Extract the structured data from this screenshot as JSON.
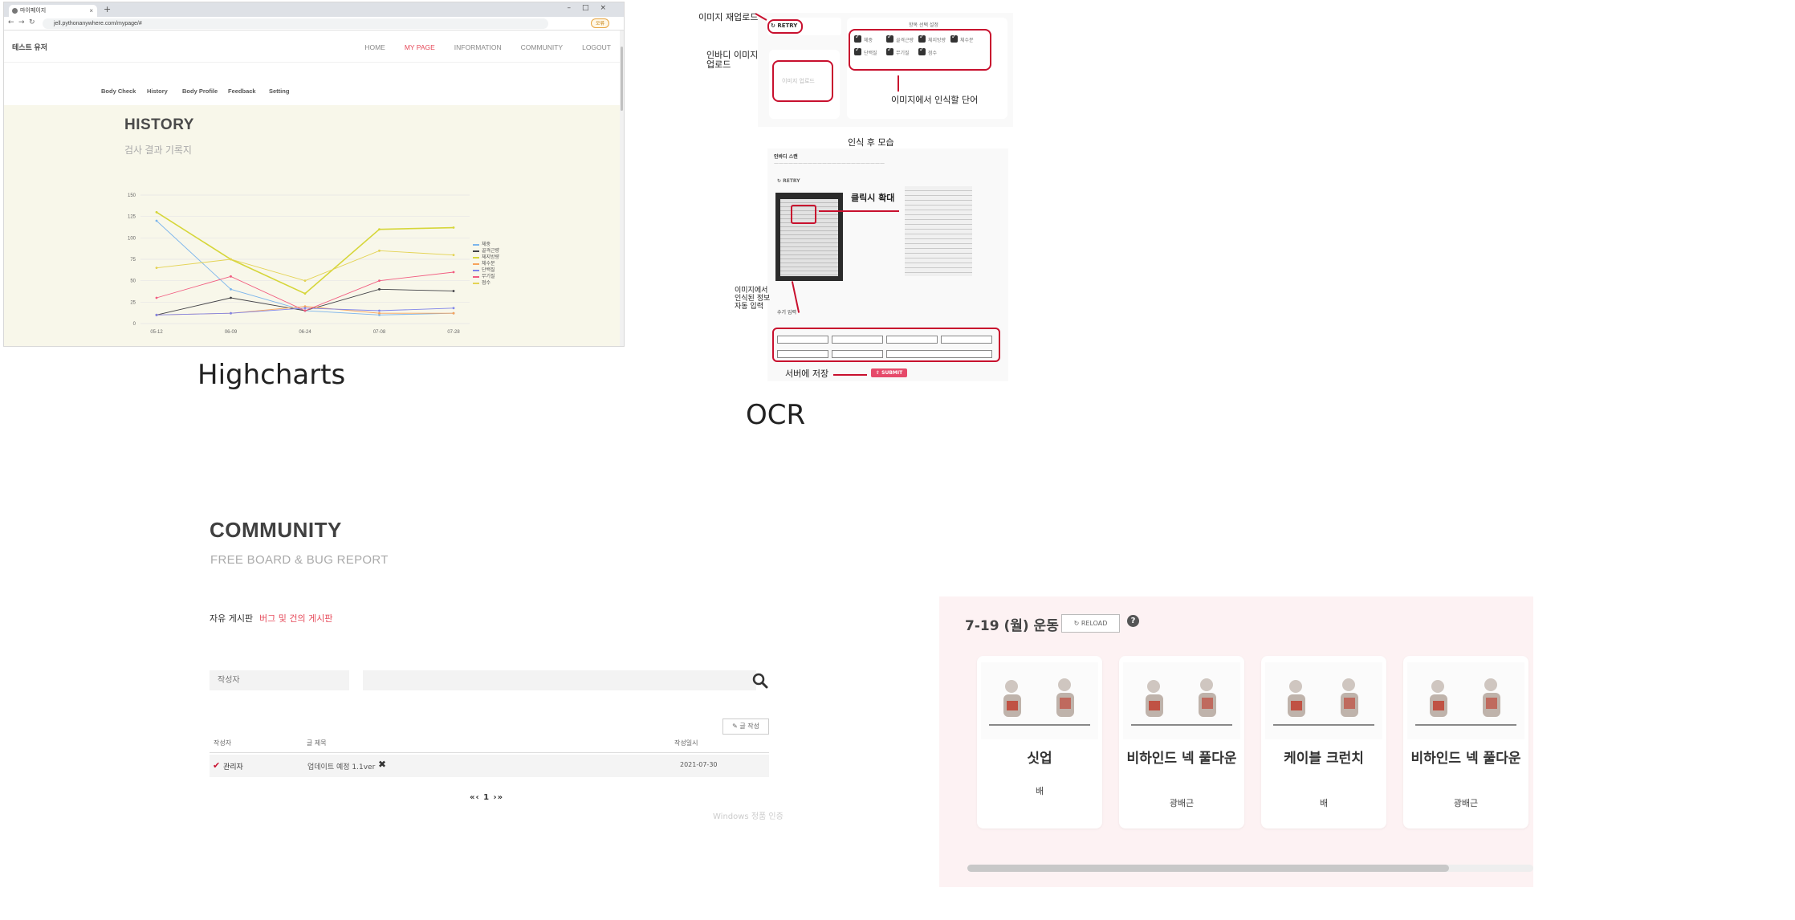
{
  "browser": {
    "tab_title": "마이페이지",
    "url": "jell.pythonanywhere.com/mypage/#",
    "account_badge": "오류"
  },
  "site": {
    "brand": "테스트 유저",
    "menu": [
      "HOME",
      "MY PAGE",
      "INFORMATION",
      "COMMUNITY",
      "LOGOUT"
    ],
    "active_menu": "MY PAGE",
    "accent": "#e64a5a"
  },
  "subnav": [
    "Body Check",
    "History",
    "Body Profile",
    "Feedback",
    "Setting"
  ],
  "history": {
    "title": "HISTORY",
    "subtitle": "검사 결과 기록지"
  },
  "chart_data": {
    "type": "line",
    "categories": [
      "05-12",
      "06-09",
      "06-24",
      "07-08",
      "07-28"
    ],
    "ylim": [
      0,
      150
    ],
    "yticks": [
      0,
      25,
      50,
      75,
      100,
      125,
      150
    ],
    "grid": true,
    "legend_position": "right",
    "series": [
      {
        "name": "체중",
        "color": "#7cb5ec",
        "values": [
          120,
          40,
          15,
          10,
          12
        ]
      },
      {
        "name": "골격근량",
        "color": "#434348",
        "values": [
          10,
          30,
          15,
          40,
          38
        ]
      },
      {
        "name": "체지방량",
        "color": "#d6d63a",
        "values": [
          130,
          75,
          35,
          110,
          112
        ]
      },
      {
        "name": "체수분",
        "color": "#f7a35c",
        "values": [
          10,
          12,
          20,
          12,
          12
        ]
      },
      {
        "name": "단백질",
        "color": "#8085e9",
        "values": [
          10,
          12,
          18,
          15,
          18
        ]
      },
      {
        "name": "무기질",
        "color": "#f15c80",
        "values": [
          30,
          55,
          15,
          50,
          60
        ]
      },
      {
        "name": "점수",
        "color": "#e4d354",
        "values": [
          65,
          75,
          50,
          85,
          80
        ]
      }
    ]
  },
  "captions": {
    "left": "Highcharts",
    "right": "OCR"
  },
  "ocr": {
    "image_reupload_label": "이미지 재업로드",
    "inbody_upload_label": "인바디 이미지\n업로드",
    "upload_placeholder": "이미지 업로드",
    "reload_btn": "RETRY",
    "checkbox_caption": "이미지에서 인식할 단어",
    "after_caption": "인식 후 모습",
    "zoom_caption": "클릭시 확대",
    "auto_caption": "이미지에서\n인식된 정보\n자동 입력",
    "save_caption": "서버에 저장",
    "submit": "SUBMIT",
    "section_title": "인바디 스캔",
    "check_items": [
      "체중",
      "골격근량",
      "체지방량",
      "체수분",
      "단백질",
      "무기질",
      "점수"
    ]
  },
  "community": {
    "title": "COMMUNITY",
    "subtitle": "FREE BOARD & BUG REPORT",
    "tabs": [
      "자유 게시판",
      "버그 및 건의 게시판"
    ],
    "category_placeholder": "작성자",
    "write_button": "글 작성",
    "columns": [
      "작성자",
      "글 제목",
      "작성일시"
    ],
    "rows": [
      {
        "author": "관리자",
        "title": "업데이트 예정 1.1ver",
        "date": "2021-07-30"
      }
    ],
    "pager": "«‹ 1 ›»",
    "watermark": "Windows 정품 인증"
  },
  "exercise": {
    "title": "7-19 (월) 운동",
    "reload": "RELOAD",
    "help": "?",
    "cards": [
      {
        "name": "싯업",
        "part": "배"
      },
      {
        "name": "비하인드 넥 풀다운",
        "part": "광배근"
      },
      {
        "name": "케이블 크런치",
        "part": "배"
      },
      {
        "name": "비하인드 넥 풀다운",
        "part": "광배근"
      }
    ]
  }
}
